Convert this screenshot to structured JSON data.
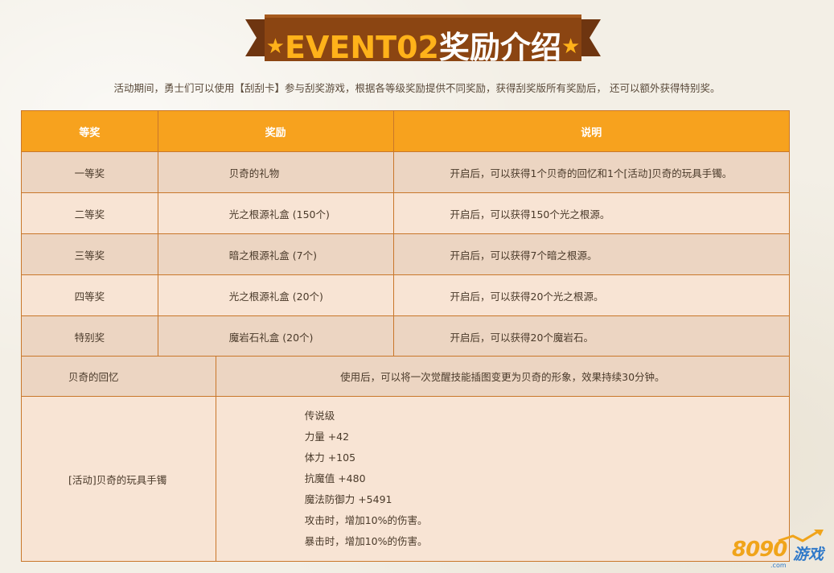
{
  "banner": {
    "star_left": "★",
    "title_en": "EVENT02",
    "title_cn": "奖励介绍",
    "star_right": "★"
  },
  "intro": "活动期间，勇士们可以使用【刮刮卡】参与刮奖游戏，根据各等级奖励提供不同奖励，获得刮奖版所有奖励后， 还可以额外获得特别奖。",
  "reward_table": {
    "headers": [
      "等奖",
      "奖励",
      "说明"
    ],
    "rows": [
      {
        "tier": "一等奖",
        "reward": "贝奇的礼物",
        "desc": "开启后，可以获得1个贝奇的回忆和1个[活动]贝奇的玩具手镯。"
      },
      {
        "tier": "二等奖",
        "reward": "光之根源礼盒 (150个)",
        "desc": "开启后，可以获得150个光之根源。"
      },
      {
        "tier": "三等奖",
        "reward": "暗之根源礼盒 (7个)",
        "desc": "开启后，可以获得7个暗之根源。"
      },
      {
        "tier": "四等奖",
        "reward": "光之根源礼盒 (20个)",
        "desc": "开启后，可以获得20个光之根源。"
      },
      {
        "tier": "特别奖",
        "reward": "魔岩石礼盒 (20个)",
        "desc": "开启后，可以获得20个魔岩石。"
      }
    ]
  },
  "item_table": {
    "memory": {
      "name": "贝奇的回忆",
      "desc": "使用后，可以将一次觉醒技能插图变更为贝奇的形象，效果持续30分钟。"
    },
    "bracelet": {
      "name": "[活动]贝奇的玩具手镯",
      "stats": [
        "传说级",
        "力量 +42",
        "体力 +105",
        "抗魔值 +480",
        "魔法防御力 +5491",
        "攻击时，增加10%的伤害。",
        "暴击时，增加10%的伤害。"
      ]
    }
  },
  "watermark": {
    "number": "8090",
    "text": "游戏",
    "sub": ".com"
  },
  "colors": {
    "banner_bg": "#8b4512",
    "header_orange": "#f7a21e",
    "row_dark": "#ecd5c2",
    "row_light": "#f8e4d4",
    "border": "#c9772a"
  }
}
